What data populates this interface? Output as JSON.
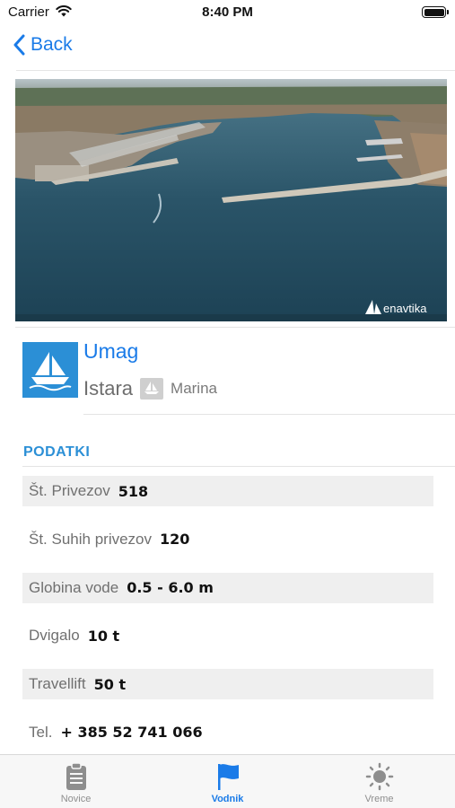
{
  "status_bar": {
    "carrier": "Carrier",
    "time": "8:40 PM"
  },
  "nav": {
    "back_label": "Back"
  },
  "hero": {
    "watermark": "enavtika"
  },
  "marina": {
    "name": "Umag",
    "region": "Istara",
    "type": "Marina",
    "icon": "sailboat-icon",
    "accent": "#2b8fd6"
  },
  "details": {
    "section_title": "PODATKI",
    "rows": [
      {
        "label": "Št. Privezov",
        "value": "518"
      },
      {
        "label": "Št. Suhih privezov",
        "value": "120"
      },
      {
        "label": "Globina vode",
        "value": "0.5 - 6.0 m"
      },
      {
        "label": "Dvigalo",
        "value": "10 t"
      },
      {
        "label": "Travellift",
        "value": "50 t"
      },
      {
        "label": "Tel.",
        "value": "+ 385 52 741 066"
      }
    ]
  },
  "tabs": [
    {
      "label": "Novice",
      "icon": "clipboard-icon",
      "active": false
    },
    {
      "label": "Vodnik",
      "icon": "flag-icon",
      "active": true
    },
    {
      "label": "Vreme",
      "icon": "sun-icon",
      "active": false
    }
  ],
  "colors": {
    "link_blue": "#1a7be8",
    "tab_inactive": "#8e8e8e"
  }
}
